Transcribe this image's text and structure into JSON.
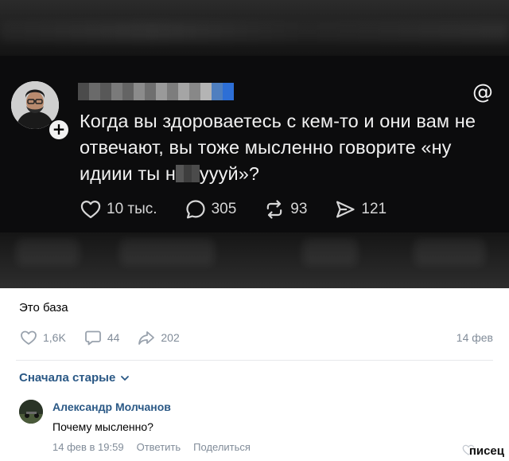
{
  "threads_post": {
    "text_part1": "Когда вы здороваетесь с кем-то и они вам не отвечают, вы тоже мысленно говорите «ну идиии ты н",
    "text_part2": "уууй»?",
    "likes": "10 тыс.",
    "comments": "305",
    "reposts": "93",
    "shares": "121"
  },
  "vk_post": {
    "caption": "Это база",
    "likes": "1,6K",
    "comments": "44",
    "shares": "202",
    "date": "14 фев"
  },
  "comments_section": {
    "sort_label": "Сначала старые",
    "comment": {
      "author": "Александр Молчанов",
      "text": "Почему мысленно?",
      "timestamp": "14 фев в 19:59",
      "reply_label": "Ответить",
      "share_label": "Поделиться"
    }
  },
  "watermark": "писец",
  "colors": {
    "vk_link": "#2a5885",
    "vk_gray": "#818c99",
    "dark_bg": "#0c0c0d"
  }
}
